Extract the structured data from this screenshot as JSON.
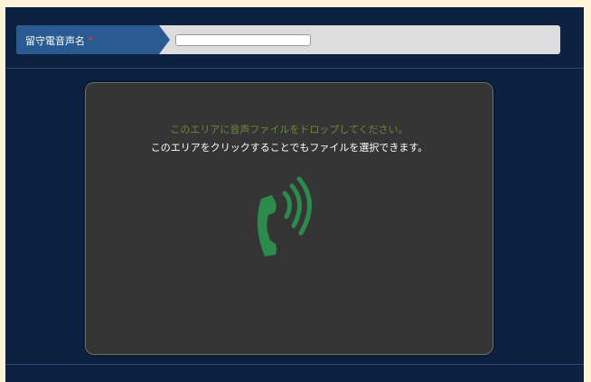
{
  "form": {
    "label": "留守電音声名",
    "required_mark": "*",
    "name_input": {
      "value": "",
      "placeholder": ""
    }
  },
  "drop_zone": {
    "message_primary": "このエリアに音声ファイルをドロップしてください。",
    "message_secondary": "このエリアをクリックすることでもファイルを選択できます。",
    "icon": "phone-sound-icon"
  },
  "colors": {
    "background": "#0c2240",
    "label_bg": "#2a5a92",
    "drop_zone_bg": "#353535",
    "icon_color": "#2c8a4c",
    "primary_message": "#6c8a3c"
  }
}
